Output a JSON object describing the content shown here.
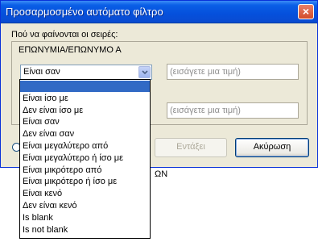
{
  "background": {
    "cell_text": "ΩΝ"
  },
  "dialog": {
    "title": "Προσαρμοσμένο αυτόματο φίλτρο",
    "close_glyph": "×",
    "which_rows_label": "Πού να φαίνονται οι σειρές:",
    "group_title": "ΕΠΩΝΥΜΙΑ/ΕΠΩΝΥΜΟ Α",
    "condition1": {
      "selected": "Είναι σαν"
    },
    "value_placeholder": "(εισάγετε μια τιμή)",
    "ok_label": "Εντάξει",
    "cancel_label": "Ακύρωση"
  },
  "dropdown": {
    "items": [
      "",
      "Είναι ίσο με",
      "Δεν είναι ίσο με",
      "Είναι σαν",
      "Δεν είναι σαν",
      "Είναι μεγαλύτερο από",
      "Είναι μεγαλύτερο ή ίσο με",
      "Είναι μικρότερο από",
      "Είναι μικρότερο ή ίσο με",
      "Είναι κενό",
      "Δεν είναι κενό",
      "Is blank",
      "Is not blank"
    ],
    "selected_index": 0
  },
  "colors": {
    "title_bar": "#0550dc",
    "selection": "#316ac5",
    "dialog_bg": "#ece9d8"
  }
}
